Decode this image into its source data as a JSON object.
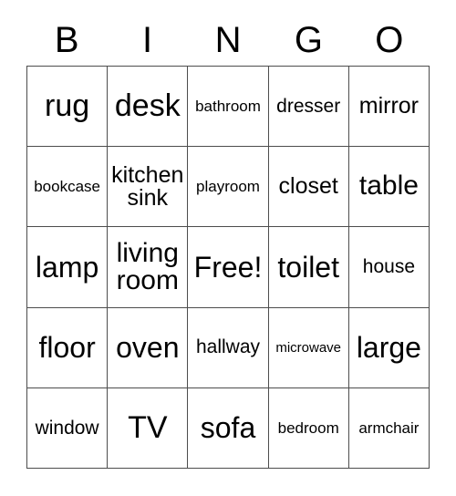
{
  "card": {
    "header": {
      "letters": [
        "B",
        "I",
        "N",
        "G",
        "O"
      ]
    },
    "rows": [
      [
        {
          "text": "rug",
          "size": "s-xxl"
        },
        {
          "text": "desk",
          "size": "s-xxl"
        },
        {
          "text": "bathroom",
          "size": "s-xs"
        },
        {
          "text": "dresser",
          "size": "s-sm"
        },
        {
          "text": "mirror",
          "size": "s-md"
        }
      ],
      [
        {
          "text": "bookcase",
          "size": "s-xs"
        },
        {
          "text": "kitchen\nsink",
          "size": "s-md",
          "lines": 2
        },
        {
          "text": "playroom",
          "size": "s-xs"
        },
        {
          "text": "closet",
          "size": "s-md"
        },
        {
          "text": "table",
          "size": "s-lg"
        }
      ],
      [
        {
          "text": "lamp",
          "size": "s-xl"
        },
        {
          "text": "living\nroom",
          "size": "s-lg",
          "lines": 2
        },
        {
          "text": "Free!",
          "size": "s-xl"
        },
        {
          "text": "toilet",
          "size": "s-xl"
        },
        {
          "text": "house",
          "size": "s-sm"
        }
      ],
      [
        {
          "text": "floor",
          "size": "s-xl"
        },
        {
          "text": "oven",
          "size": "s-xl"
        },
        {
          "text": "hallway",
          "size": "s-sm"
        },
        {
          "text": "microwave",
          "size": "s-xxs"
        },
        {
          "text": "large",
          "size": "s-xl"
        }
      ],
      [
        {
          "text": "window",
          "size": "s-sm"
        },
        {
          "text": "TV",
          "size": "s-xxl"
        },
        {
          "text": "sofa",
          "size": "s-xl"
        },
        {
          "text": "bedroom",
          "size": "s-xs"
        },
        {
          "text": "armchair",
          "size": "s-xs"
        }
      ]
    ],
    "colors": {
      "background": "#ffffff",
      "text": "#000000",
      "border": "#4d4d4d"
    }
  }
}
